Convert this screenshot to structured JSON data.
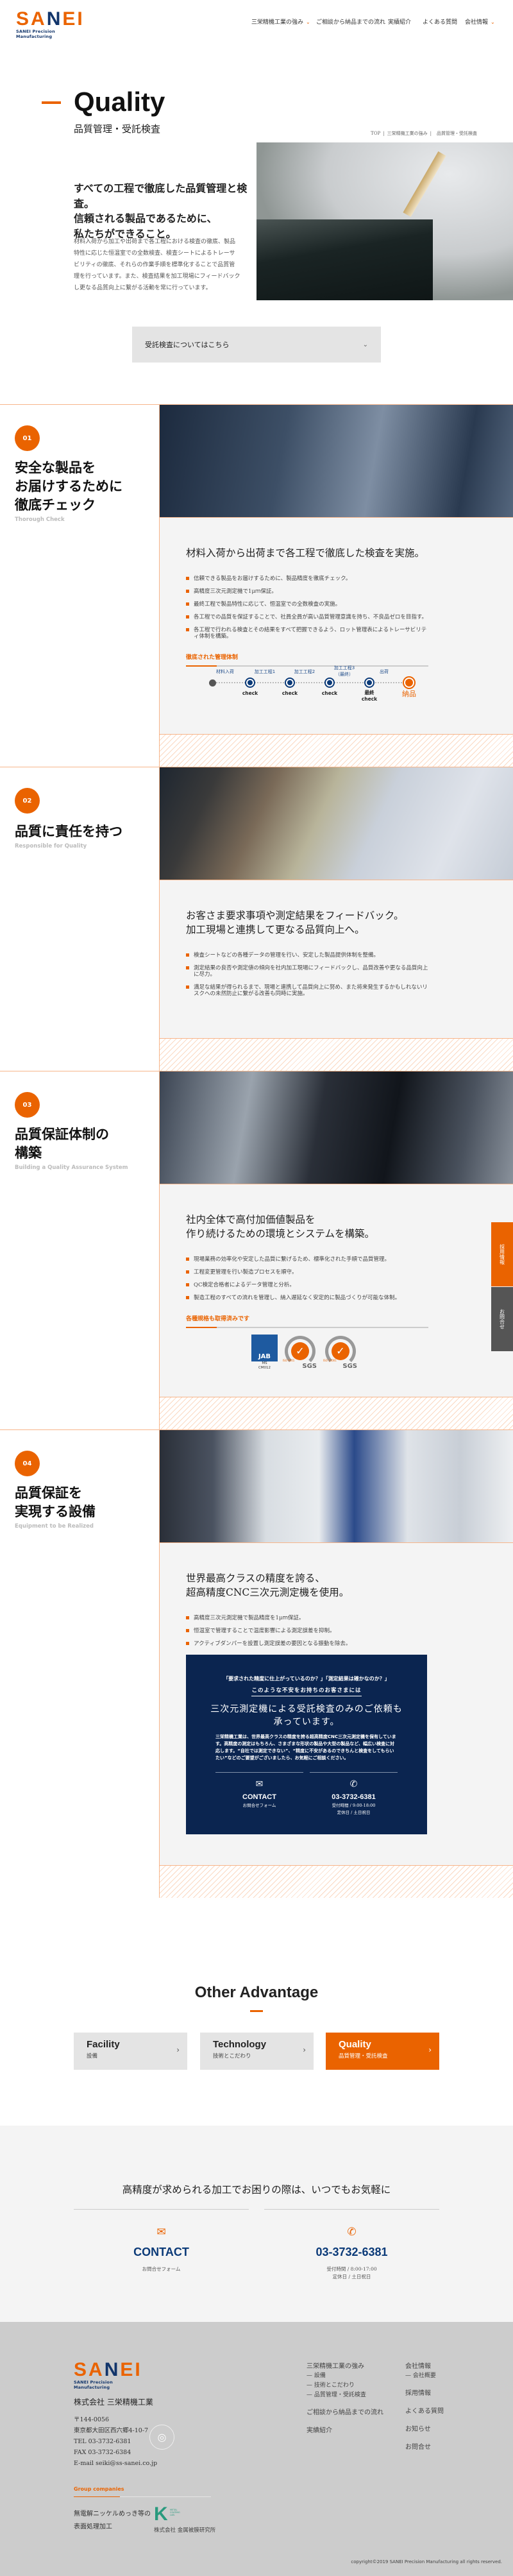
{
  "header": {
    "logo_text": "SANEI",
    "logo_tagline": "SANEI Precision Manufacturing",
    "nav": [
      {
        "label": "三栄精機工業の強み",
        "has_dropdown": true
      },
      {
        "label": "ご相談から納品までの流れ",
        "has_dropdown": false
      },
      {
        "label": "実績紹介",
        "has_dropdown": false
      },
      {
        "label": "よくある質問",
        "has_dropdown": false
      },
      {
        "label": "会社情報",
        "has_dropdown": true
      }
    ],
    "chevron": "⌄"
  },
  "hero": {
    "title": "Quality",
    "subtitle": "品質管理・受託検査",
    "breadcrumb": [
      "TOP",
      "三栄精機工業の強み",
      "品質管理・受託検査"
    ],
    "breadcrumb_sep": "|"
  },
  "intro": {
    "headline": [
      "すべての工程で徹底した品質管理と検査。",
      "信頼される製品であるために、",
      "私たちができること。"
    ],
    "body": "材料入荷から加工や出荷まで各工程における検査の徹底、製品特性に応じた恒温室での全数検査、検査シートによるトレーサビリティの徹底、それらの作業手順を標準化することで品質管理を行っています。また、検査結果を加工現場にフィードバックし更なる品質向上に繋がる活動を常に行っています。",
    "button_label": "受託検査についてはこちら",
    "button_icon": "chevron-down"
  },
  "sections": [
    {
      "num": "01",
      "title": [
        "安全な製品を",
        "お届けするために",
        "徹底チェック"
      ],
      "subtitle": "Thorough Check",
      "heading": [
        "材料入荷から出荷まで各工程で徹底した検査を実施。"
      ],
      "bullets": [
        "信頼できる製品をお届けするために、製品精度を徹底チェック。",
        "高精度三次元測定機で1μｍ保証。",
        "最終工程で製品特性に応じて、恒温室での全数検査の実施。",
        "各工程での品質を保証することで、社員全員が高い品質管理意識を持ち、不良品ゼロを目指す。",
        "各工程で行われる検査とその結果をすべて把握できるよう、ロット管理表によるトレーサビリティ体制を構築。"
      ],
      "label": "徹底された管理体制",
      "flow": {
        "stages": [
          "材料入荷",
          "加工工程1",
          "加工工程2",
          "加工工程3\n（最終）",
          "出荷"
        ],
        "checks": [
          "check",
          "check",
          "check",
          "最終\ncheck"
        ],
        "end": "納品"
      }
    },
    {
      "num": "02",
      "title": [
        "品質に責任を持つ"
      ],
      "subtitle": "Responsible for Quality",
      "heading": [
        "お客さま要求事項や測定結果をフィードバック。",
        "加工現場と連携して更なる品質向上へ。"
      ],
      "bullets": [
        "検査シートなどの各種データの管理を行い、安定した製品提供体制を整備。",
        "測定結果の良否や測定値の傾向を社内加工現場にフィードバックし、品質改善や更なる品質向上に尽力。",
        "満足な結果が得られるまで、現場と連携して品質向上に努め、また将来発生するかもしれないリスクへの未然防止に繋がる改善も同時に実施。"
      ]
    },
    {
      "num": "03",
      "title": [
        "品質保証体制の",
        "構築"
      ],
      "subtitle": "Building a Quality Assurance System",
      "heading": [
        "社内全体で高付加価値製品を",
        "作り続けるための環境とシステムを構築。"
      ],
      "bullets": [
        "現場業務の効率化や安定した品質に繋げるため、標準化された手順で品質管理。",
        "工程変更管理を行い製造プロセスを順守。",
        "QC検定合格者によるデータ管理と分析。",
        "製造工程のすべての流れを管理し、納入遅延なく安定的に製品づくりが可能な体制。"
      ],
      "label": "各種規格も取得済みです",
      "certs": [
        {
          "name": "JAB",
          "code": "MS\nCM012"
        },
        {
          "name": "SGS",
          "standard": "ISO 9001"
        },
        {
          "name": "SGS",
          "standard": "ISO 14001"
        }
      ]
    },
    {
      "num": "04",
      "title": [
        "品質保証を",
        "実現する設備"
      ],
      "subtitle": "Equipment to be Realized",
      "heading": [
        "世界最高クラスの精度を誇る、",
        "超高精度CNC三次元測定機を使用。"
      ],
      "bullets": [
        "高精度三次元測定機で製品精度を1μｍ保証。",
        "恒温室で管理することで温度影響による測定誤差を抑制。",
        "アクティブダンパーを設置し測定誤差の要因となる振動を除去。"
      ],
      "promo": {
        "question": "「要求された精度に仕上がっているのか？」「測定結果は確かなのか？」",
        "lead": "このような不安をお持ちのお客さまには",
        "headline": [
          "三次元測定機による受託検査のみのご依頼も",
          "承っています。"
        ],
        "body": "三栄精機工業は、世界最高クラスの精度を誇る超高精度CNC三次元測定機を保有しています。高精度の測定はもちろん、さまざまな形状の製品や大型の製品など、幅広い検査に対応します。“自社では測定できない”、“精度に不安があるのできちんと検査をしてもらいたい”などのご要望がございましたら、お気軽にご相談ください。",
        "contact_title": "CONTACT",
        "contact_sub": "お問合せフォーム",
        "phone": "03-3732-6381",
        "hours": "受付時間 / 9:00-18:00",
        "closed": "定休日 / 土日祝日"
      }
    }
  ],
  "side_tabs": [
    {
      "label": "採用情報",
      "color": "#ea6300"
    },
    {
      "label": "お問合せ",
      "color": "#555555"
    }
  ],
  "other_advantage": {
    "title": "Other Advantage",
    "cards": [
      {
        "title": "Facility",
        "sub": "設備",
        "active": false
      },
      {
        "title": "Technology",
        "sub": "技術とこだわり",
        "active": false
      },
      {
        "title": "Quality",
        "sub": "品質管理・受託検査",
        "active": true
      }
    ],
    "chevron": "›"
  },
  "contact": {
    "heading": "高精度が求められる加工でお困りの際は、いつでもお気軽に",
    "contact_title": "CONTACT",
    "contact_sub": "お問合せフォーム",
    "phone": "03-3732-6381",
    "hours": "受付時間 / 8:00-17:00",
    "closed": "定休日 / 土日祝日"
  },
  "footer": {
    "company": "株式会社 三栄精機工業",
    "address": [
      "〒144-0056",
      "東京都大田区西六郷4-10-7",
      "TEL 03-3732-6381",
      "FAX 03-3732-6384",
      "E-mail seiki@ss-sanei.co.jp"
    ],
    "nav_col1": {
      "strength": "三栄精機工業の強み",
      "sub": [
        "設備",
        "技術とこだわり",
        "品質管理・受託検査"
      ],
      "flow": "ご相談から納品までの流れ",
      "works": "実績紹介"
    },
    "nav_col2": {
      "company": "会社情報",
      "sub": [
        "会社概要"
      ],
      "items": [
        "採用情報",
        "よくある質問",
        "お知らせ",
        "お問合せ"
      ]
    },
    "group_label": "Group companies",
    "group_desc": [
      "無電解ニッケルめっき等の",
      "表面処理加工"
    ],
    "group_logo_text": "METAL COATING LAB.",
    "group_company": "株式会社 金属被膜研究所",
    "copyright": "copyright©2019 SANEI Precision Manufacturing all rights reserved."
  },
  "colors": {
    "accent": "#ea6300",
    "navy": "#0b2550",
    "section_bg": "#f4f4f4",
    "footer_bg": "#cccccc"
  }
}
